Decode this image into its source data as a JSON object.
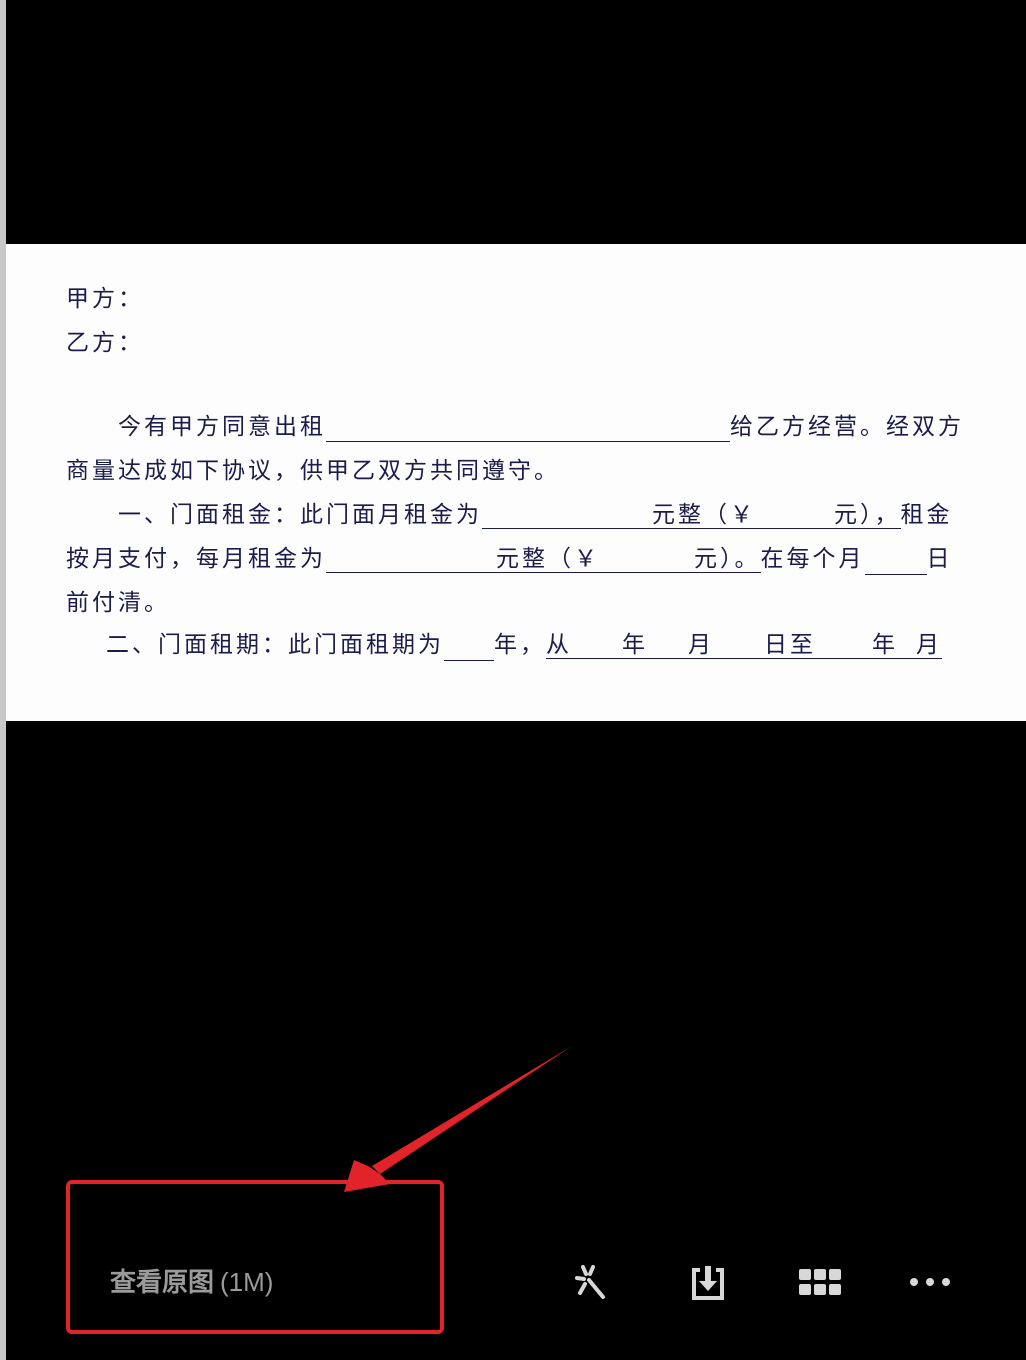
{
  "document": {
    "party_a": "甲方：",
    "party_b": "乙方：",
    "para1_start": "今有甲方同意出租",
    "para1_end": "给乙方经营。经双方",
    "para1_line2": "商量达成如下协议，供甲乙双方共同遵守。",
    "rent_label": "一、门面租金：此门面月租金为",
    "yuan_zheng": "元整（",
    "yen": "￥",
    "yuan_close": "元），",
    "rent_tail": "租金",
    "monthly_start": "按月支付，每月租金为",
    "yuan_zheng_2": "元整（",
    "yen_2": "￥",
    "yuan_close_2": "元）。",
    "each_month": "在每个月",
    "day": "日",
    "pay_clear": "前付清。",
    "term_label": "二、门面租期：此门面租期为",
    "year": "年，",
    "from": "从",
    "year2": "年",
    "month": "月",
    "day_to": "日至",
    "year3": "年",
    "month2": "月"
  },
  "toolbar": {
    "view_original_label": "查看原图",
    "view_original_size": "(1M)",
    "icons": [
      "magic-wand-icon",
      "download-icon",
      "grid-icon",
      "more-icon"
    ]
  },
  "colors": {
    "highlight": "#e0242a",
    "text_gray": "#9a9a9a",
    "doc_ink": "#1c1c4a"
  }
}
